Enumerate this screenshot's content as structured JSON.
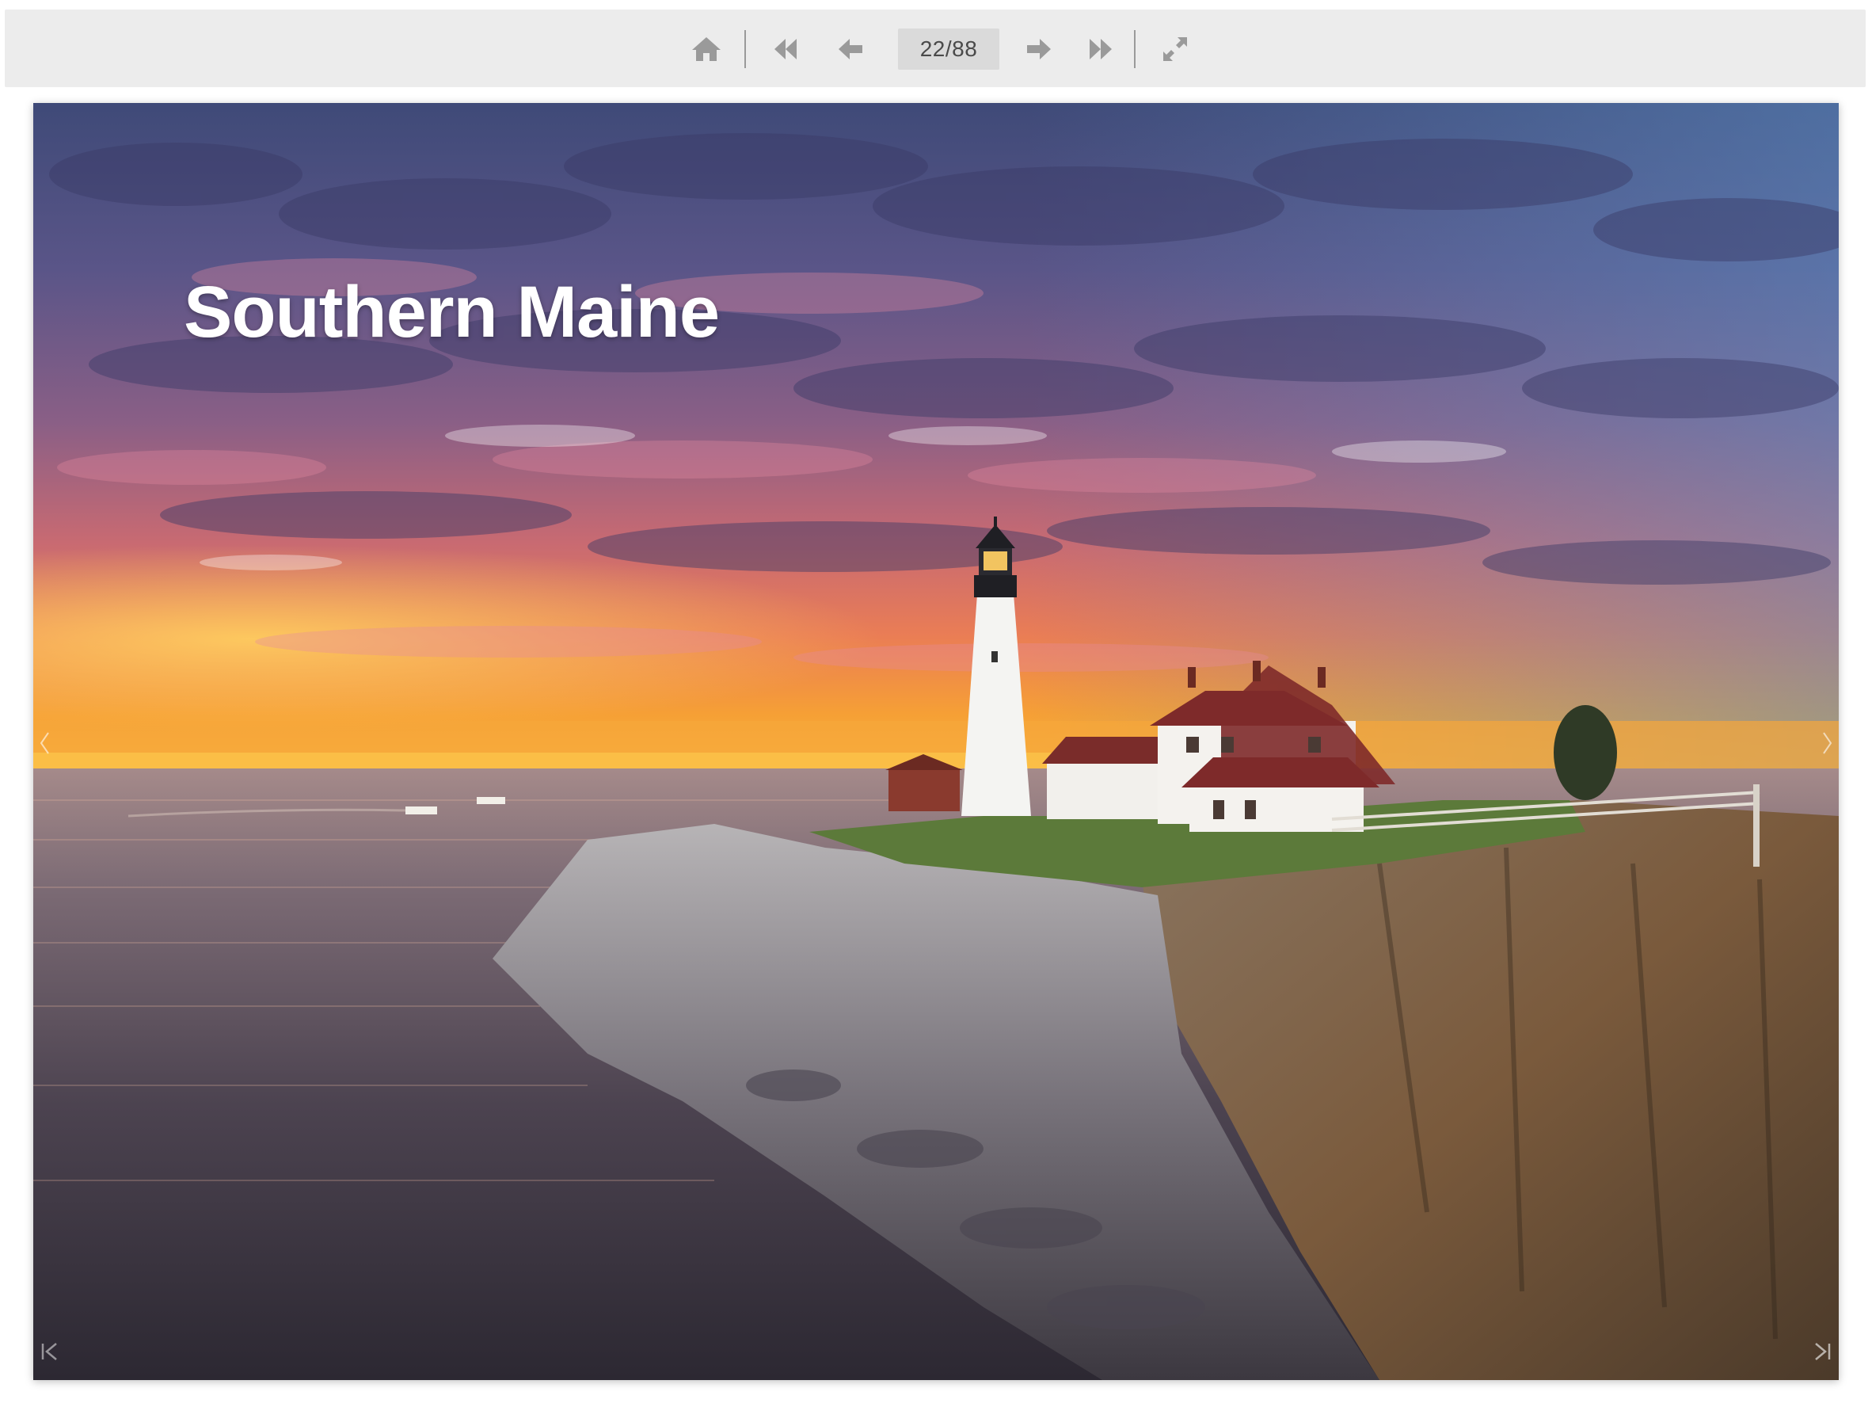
{
  "toolbar": {
    "buttons": [
      {
        "name": "home",
        "icon": "home-icon"
      },
      {
        "name": "first-page",
        "icon": "double-arrow-left-icon"
      },
      {
        "name": "previous-page",
        "icon": "arrow-left-icon"
      },
      {
        "name": "next-page",
        "icon": "arrow-right-icon"
      },
      {
        "name": "last-page",
        "icon": "double-arrow-right-icon"
      },
      {
        "name": "fullscreen",
        "icon": "expand-icon"
      }
    ],
    "page_counter": "22/88",
    "icon_color": "#9a9a9a"
  },
  "page": {
    "title": "Southern Maine",
    "image": "lighthouse-sunset-photo",
    "left_edge_icon": "chevron-left-icon",
    "right_edge_icon": "chevron-right-icon",
    "bottom_left_icon": "skip-to-start-icon",
    "bottom_right_icon": "skip-to-end-icon"
  }
}
